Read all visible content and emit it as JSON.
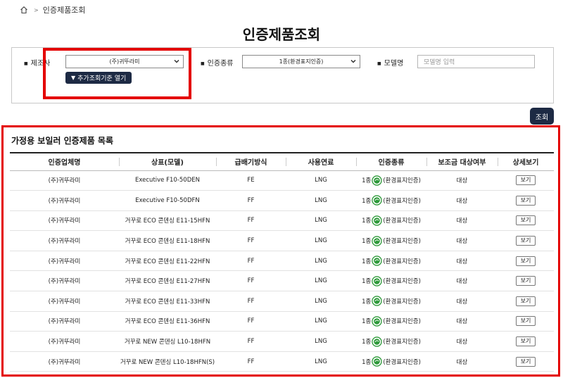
{
  "breadcrumb": {
    "current": "인증제품조회"
  },
  "page": {
    "title": "인증제품조회"
  },
  "search": {
    "manufacturer_label": "제조사",
    "manufacturer_value": "(주)귀뚜라미",
    "cert_type_label": "인증종류",
    "cert_type_value": "1종(환경표지인증)",
    "model_label": "모델명",
    "model_placeholder": "모델명 입력",
    "advanced_button": "추가조회기준 열기",
    "query_button": "조회"
  },
  "list": {
    "title": "가정용 보일러 인증제품 목록",
    "columns": [
      "인증업체명",
      "상표(모델)",
      "급배기방식",
      "사용연료",
      "인증종류",
      "보조금 대상여부",
      "상세보기"
    ],
    "rows": [
      {
        "company": "(주)귀뚜라미",
        "model": "Executive F10-50DEN",
        "exhaust": "FE",
        "fuel": "LNG",
        "cert_pre": "1종",
        "cert_post": "(환경표지인증)",
        "subsidy": "대상",
        "view": "보기"
      },
      {
        "company": "(주)귀뚜라미",
        "model": "Executive F10-50DFN",
        "exhaust": "FF",
        "fuel": "LNG",
        "cert_pre": "1종",
        "cert_post": "(환경표지인증)",
        "subsidy": "대상",
        "view": "보기"
      },
      {
        "company": "(주)귀뚜라미",
        "model": "거꾸로 ECO 콘덴싱 E11-15HFN",
        "exhaust": "FF",
        "fuel": "LNG",
        "cert_pre": "1종",
        "cert_post": "(환경표지인증)",
        "subsidy": "대상",
        "view": "보기"
      },
      {
        "company": "(주)귀뚜라미",
        "model": "거꾸로 ECO 콘덴싱 E11-18HFN",
        "exhaust": "FF",
        "fuel": "LNG",
        "cert_pre": "1종",
        "cert_post": "(환경표지인증)",
        "subsidy": "대상",
        "view": "보기"
      },
      {
        "company": "(주)귀뚜라미",
        "model": "거꾸로 ECO 콘덴싱 E11-22HFN",
        "exhaust": "FF",
        "fuel": "LNG",
        "cert_pre": "1종",
        "cert_post": "(환경표지인증)",
        "subsidy": "대상",
        "view": "보기"
      },
      {
        "company": "(주)귀뚜라미",
        "model": "거꾸로 ECO 콘덴싱 E11-27HFN",
        "exhaust": "FF",
        "fuel": "LNG",
        "cert_pre": "1종",
        "cert_post": "(환경표지인증)",
        "subsidy": "대상",
        "view": "보기"
      },
      {
        "company": "(주)귀뚜라미",
        "model": "거꾸로 ECO 콘덴싱 E11-33HFN",
        "exhaust": "FF",
        "fuel": "LNG",
        "cert_pre": "1종",
        "cert_post": "(환경표지인증)",
        "subsidy": "대상",
        "view": "보기"
      },
      {
        "company": "(주)귀뚜라미",
        "model": "거꾸로 ECO 콘덴싱 E11-36HFN",
        "exhaust": "FF",
        "fuel": "LNG",
        "cert_pre": "1종",
        "cert_post": "(환경표지인증)",
        "subsidy": "대상",
        "view": "보기"
      },
      {
        "company": "(주)귀뚜라미",
        "model": "거꾸로 NEW 콘덴싱 L10-18HFN",
        "exhaust": "FF",
        "fuel": "LNG",
        "cert_pre": "1종",
        "cert_post": "(환경표지인증)",
        "subsidy": "대상",
        "view": "보기"
      },
      {
        "company": "(주)귀뚜라미",
        "model": "거꾸로 NEW 콘덴싱 L10-18HFN(S)",
        "exhaust": "FF",
        "fuel": "LNG",
        "cert_pre": "1종",
        "cert_post": "(환경표지인증)",
        "subsidy": "대상",
        "view": "보기"
      }
    ]
  },
  "icons": {
    "home": "home-icon",
    "dropdown": "chevron-down-icon",
    "eco_label": "eco-label-icon"
  },
  "colors": {
    "dark_button": "#1d2a44",
    "highlight_border": "#e40000",
    "eco_green": "#2e9a3a"
  }
}
